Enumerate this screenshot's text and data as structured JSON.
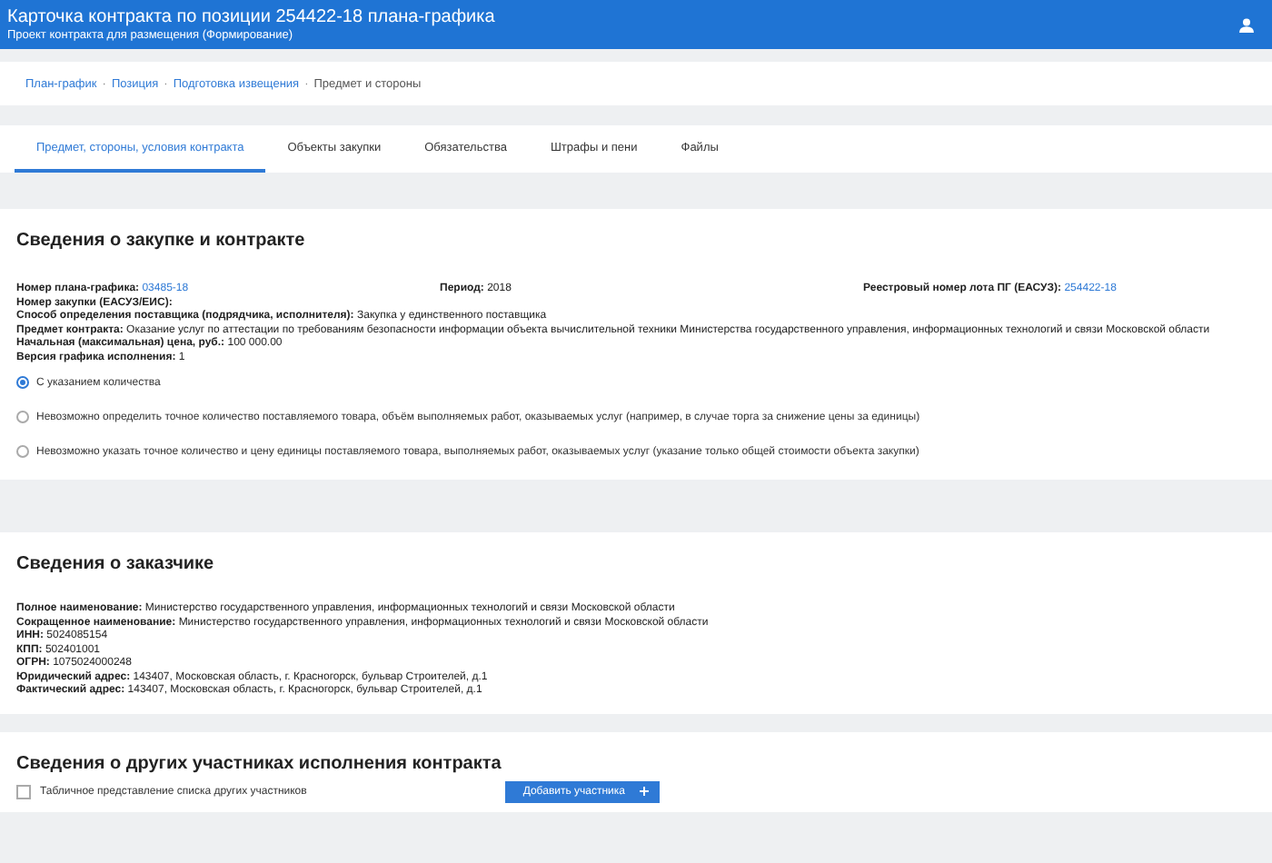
{
  "header": {
    "title": "Карточка контракта по позиции 254422-18 плана-графика",
    "subtitle": "Проект контракта для размещения (Формирование)"
  },
  "breadcrumb_separator": "·",
  "breadcrumbs": [
    {
      "label": "План-график",
      "link": true
    },
    {
      "label": "Позиция",
      "link": true
    },
    {
      "label": "Подготовка извещения",
      "link": true
    },
    {
      "label": "Предмет и стороны",
      "link": false
    }
  ],
  "tabs": [
    {
      "label": "Предмет, стороны, условия контракта",
      "selected": true
    },
    {
      "label": "Объекты закупки",
      "selected": false
    },
    {
      "label": "Обязательства",
      "selected": false
    },
    {
      "label": "Штрафы и пени",
      "selected": false
    },
    {
      "label": "Файлы",
      "selected": false
    }
  ],
  "purchase": {
    "title": "Сведения о закупке и контракте",
    "top_fields": [
      {
        "label": "Номер плана-графика:",
        "value": "03485-18",
        "link": true
      },
      {
        "label": "Период:",
        "value": "2018",
        "link": false
      },
      {
        "label": "Реестровый номер лота ПГ (ЕАСУЗ):",
        "value": "254422-18",
        "link": true
      }
    ],
    "fields": [
      {
        "label": "Номер закупки (ЕАСУЗ/ЕИС):"
      },
      {
        "label": "Способ определения поставщика (подрядчика, исполнителя):",
        "value": "Закупка у единственного поставщика"
      },
      {
        "label": "Предмет контракта:",
        "value": "Оказание услуг по аттестации по требованиям безопасности информации объекта вычислительной техники Министерства государственного управления, информационных технологий и связи Московской области"
      },
      {
        "label": "Начальная (максимальная) цена, руб.:",
        "value": "100 000.00"
      },
      {
        "label": "Версия графика исполнения:",
        "value": "1"
      }
    ],
    "options": [
      {
        "label": "С указанием количества",
        "selected": true
      },
      {
        "label": "Невозможно определить точное количество поставляемого товара, объём выполняемых работ, оказываемых услуг (например, в случае торга за снижение цены за единицы)",
        "selected": false
      },
      {
        "label": "Невозможно указать точное количество и цену единицы поставляемого товара, выполняемых работ, оказываемых услуг (указание только общей стоимости объекта закупки)",
        "selected": false
      }
    ]
  },
  "customer": {
    "title": "Сведения о заказчике",
    "fields": [
      {
        "label": "Полное наименование:",
        "value": "Министерство государственного управления, информационных технологий и связи Московской области"
      },
      {
        "label": "Сокращенное наименование:",
        "value": "Министерство государственного управления, информационных технологий и связи Московской области"
      },
      {
        "label": "ИНН:",
        "value": "5024085154"
      },
      {
        "label": "КПП:",
        "value": "502401001"
      },
      {
        "label": "ОГРН:",
        "value": "1075024000248"
      },
      {
        "label": "Юридический адрес:",
        "value": "143407, Московская область, г. Красногорск, бульвар Строителей, д.1"
      },
      {
        "label": "Фактический адрес:",
        "value": "143407, Московская область, г. Красногорск, бульвар Строителей, д.1"
      }
    ]
  },
  "participants": {
    "title": "Сведения о других участниках исполнения контракта",
    "checkbox": {
      "label": "Табличное представление списка других участников",
      "checked": false
    },
    "button": {
      "label": "Добавить участника"
    }
  }
}
